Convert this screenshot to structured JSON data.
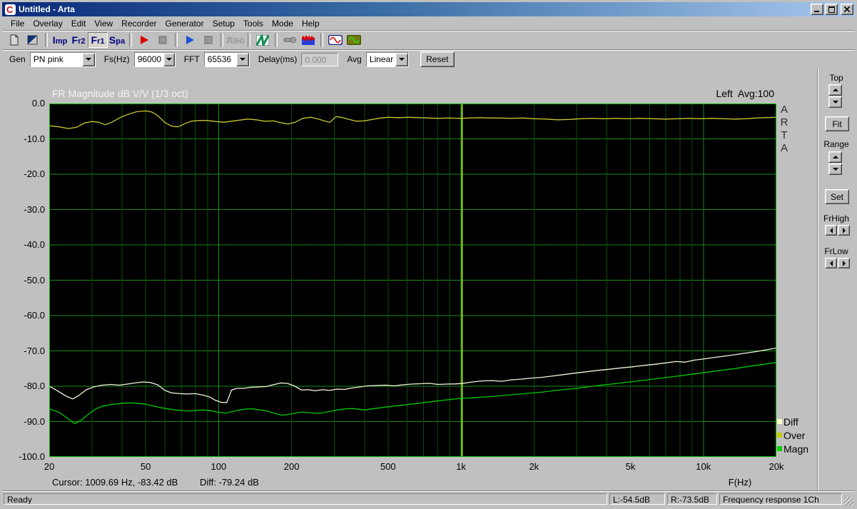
{
  "window": {
    "title": "Untitled - Arta"
  },
  "menu": {
    "items": [
      "File",
      "Overlay",
      "Edit",
      "View",
      "Recorder",
      "Generator",
      "Setup",
      "Tools",
      "Mode",
      "Help"
    ]
  },
  "toolbar": {
    "imp_label": "Imp",
    "fr2_label": "Fr2",
    "fr1_label": "Fr1",
    "spa_label": "Spa",
    "abc_label": "ABC"
  },
  "controls": {
    "gen_label": "Gen",
    "gen_value": "PN pink",
    "fs_label": "Fs(Hz)",
    "fs_value": "96000",
    "fft_label": "FFT",
    "fft_value": "65536",
    "delay_label": "Delay(ms)",
    "delay_value": "0.000",
    "avg_label": "Avg",
    "avg_value": "Linear",
    "reset_label": "Reset"
  },
  "side_panel": {
    "top_label": "Top",
    "fit_label": "Fit",
    "range_label": "Range",
    "set_label": "Set",
    "frhigh_label": "FrHigh",
    "frlow_label": "FrLow"
  },
  "status_bar": {
    "message": "Ready",
    "left_level": "L:-54.5dB",
    "right_level": "R:-73.5dB",
    "mode": "Frequency response 1Ch"
  },
  "chart_data": {
    "type": "line",
    "title": "FR Magnitude dB V/V (1/3 oct)",
    "channel_label": "Left  Avg:100",
    "xlabel": "F(Hz)",
    "x_scale": "log",
    "xlim": [
      20,
      20000
    ],
    "ylim": [
      -100,
      0
    ],
    "y_tick_labels": [
      "0.0",
      "-10.0",
      "-20.0",
      "-30.0",
      "-40.0",
      "-50.0",
      "-60.0",
      "-70.0",
      "-80.0",
      "-90.0",
      "-100.0"
    ],
    "x_ticks": [
      {
        "f": 20,
        "label": "20"
      },
      {
        "f": 50,
        "label": "50"
      },
      {
        "f": 100,
        "label": "100"
      },
      {
        "f": 200,
        "label": "200"
      },
      {
        "f": 500,
        "label": "500"
      },
      {
        "f": 1000,
        "label": "1k"
      },
      {
        "f": 2000,
        "label": "2k"
      },
      {
        "f": 5000,
        "label": "5k"
      },
      {
        "f": 10000,
        "label": "10k"
      },
      {
        "f": 20000,
        "label": "20k"
      }
    ],
    "cursor_freq": 1009.69,
    "cursor_readout": "Cursor: 1009.69 Hz, -83.42 dB",
    "diff_readout": "Diff: -79.24 dB",
    "watermark": "ARTA",
    "colors": {
      "bg": "#000000",
      "border": "#00b400",
      "grid_major": "#1d8a1d",
      "grid_minor": "#0b4c0b",
      "cursor": "#9ad500"
    },
    "legend": [
      {
        "label": "Diff",
        "color": "#ffffc8"
      },
      {
        "label": "Over",
        "color": "#c8c800"
      },
      {
        "label": "Magn",
        "color": "#00cc00"
      }
    ],
    "series": [
      {
        "name": "Over",
        "color": "#c6c632",
        "points": [
          [
            20,
            -6.3
          ],
          [
            22,
            -6.6
          ],
          [
            24,
            -7.1
          ],
          [
            26,
            -6.7
          ],
          [
            28,
            -5.5
          ],
          [
            30,
            -5.1
          ],
          [
            32,
            -5.3
          ],
          [
            34,
            -6.0
          ],
          [
            36,
            -5.4
          ],
          [
            38,
            -4.5
          ],
          [
            40,
            -3.7
          ],
          [
            43,
            -2.9
          ],
          [
            46,
            -2.3
          ],
          [
            50,
            -2.1
          ],
          [
            53,
            -2.4
          ],
          [
            56,
            -3.4
          ],
          [
            60,
            -5.4
          ],
          [
            64,
            -6.4
          ],
          [
            68,
            -6.6
          ],
          [
            72,
            -5.8
          ],
          [
            77,
            -5.0
          ],
          [
            83,
            -4.8
          ],
          [
            90,
            -4.8
          ],
          [
            97,
            -5.1
          ],
          [
            105,
            -5.3
          ],
          [
            113,
            -5.0
          ],
          [
            122,
            -4.7
          ],
          [
            132,
            -4.4
          ],
          [
            143,
            -4.6
          ],
          [
            155,
            -5.0
          ],
          [
            168,
            -4.9
          ],
          [
            180,
            -5.4
          ],
          [
            193,
            -5.8
          ],
          [
            207,
            -5.3
          ],
          [
            222,
            -4.2
          ],
          [
            240,
            -3.9
          ],
          [
            258,
            -4.4
          ],
          [
            275,
            -5.0
          ],
          [
            288,
            -5.3
          ],
          [
            305,
            -3.7
          ],
          [
            320,
            -3.9
          ],
          [
            345,
            -4.5
          ],
          [
            370,
            -5.0
          ],
          [
            400,
            -4.9
          ],
          [
            430,
            -4.5
          ],
          [
            465,
            -4.1
          ],
          [
            500,
            -3.9
          ],
          [
            550,
            -4.0
          ],
          [
            610,
            -3.9
          ],
          [
            670,
            -4.0
          ],
          [
            740,
            -4.1
          ],
          [
            810,
            -4.2
          ],
          [
            890,
            -4.1
          ],
          [
            980,
            -4.2
          ],
          [
            1080,
            -4.1
          ],
          [
            1190,
            -4.0
          ],
          [
            1310,
            -4.1
          ],
          [
            1450,
            -4.1
          ],
          [
            1600,
            -4.2
          ],
          [
            1800,
            -4.1
          ],
          [
            2000,
            -4.3
          ],
          [
            2250,
            -4.4
          ],
          [
            2500,
            -4.6
          ],
          [
            2800,
            -4.5
          ],
          [
            3100,
            -4.3
          ],
          [
            3500,
            -4.2
          ],
          [
            3900,
            -4.3
          ],
          [
            4400,
            -4.2
          ],
          [
            4900,
            -4.3
          ],
          [
            5500,
            -4.2
          ],
          [
            6200,
            -4.3
          ],
          [
            7000,
            -4.4
          ],
          [
            7800,
            -4.3
          ],
          [
            8700,
            -4.2
          ],
          [
            9700,
            -4.3
          ],
          [
            10800,
            -4.2
          ],
          [
            12000,
            -4.3
          ],
          [
            13500,
            -4.4
          ],
          [
            15000,
            -4.3
          ],
          [
            16500,
            -4.1
          ],
          [
            18000,
            -4.0
          ],
          [
            20000,
            -3.9
          ]
        ]
      },
      {
        "name": "Diff",
        "color": "#f4f4dc",
        "points": [
          [
            20,
            -80.0
          ],
          [
            21.5,
            -81.2
          ],
          [
            23.5,
            -82.8
          ],
          [
            25,
            -83.6
          ],
          [
            26.5,
            -82.6
          ],
          [
            28.5,
            -81.0
          ],
          [
            30.5,
            -80.2
          ],
          [
            33,
            -79.7
          ],
          [
            36,
            -79.5
          ],
          [
            39,
            -79.7
          ],
          [
            42,
            -79.4
          ],
          [
            45,
            -79.1
          ],
          [
            48.5,
            -78.8
          ],
          [
            52,
            -78.9
          ],
          [
            56,
            -79.6
          ],
          [
            60,
            -81.2
          ],
          [
            64,
            -81.9
          ],
          [
            69,
            -82.1
          ],
          [
            74,
            -82.2
          ],
          [
            80,
            -82.1
          ],
          [
            86,
            -82.5
          ],
          [
            92,
            -83.1
          ],
          [
            97,
            -84.0
          ],
          [
            103,
            -84.6
          ],
          [
            108,
            -84.6
          ],
          [
            113,
            -81.1
          ],
          [
            119,
            -80.6
          ],
          [
            127,
            -80.6
          ],
          [
            136,
            -80.3
          ],
          [
            146,
            -80.2
          ],
          [
            157,
            -80.1
          ],
          [
            168,
            -79.6
          ],
          [
            180,
            -79.1
          ],
          [
            192,
            -79.2
          ],
          [
            205,
            -79.9
          ],
          [
            220,
            -81.1
          ],
          [
            235,
            -81.0
          ],
          [
            250,
            -81.3
          ],
          [
            268,
            -81.0
          ],
          [
            288,
            -81.2
          ],
          [
            308,
            -80.8
          ],
          [
            330,
            -80.9
          ],
          [
            355,
            -80.5
          ],
          [
            382,
            -80.2
          ],
          [
            412,
            -79.9
          ],
          [
            448,
            -79.8
          ],
          [
            488,
            -79.7
          ],
          [
            530,
            -79.9
          ],
          [
            575,
            -79.6
          ],
          [
            625,
            -79.4
          ],
          [
            680,
            -79.3
          ],
          [
            740,
            -79.2
          ],
          [
            805,
            -79.5
          ],
          [
            875,
            -79.4
          ],
          [
            945,
            -79.35
          ],
          [
            1010,
            -79.24
          ],
          [
            1110,
            -78.8
          ],
          [
            1220,
            -78.5
          ],
          [
            1340,
            -78.4
          ],
          [
            1470,
            -78.6
          ],
          [
            1610,
            -78.2
          ],
          [
            1770,
            -78.0
          ],
          [
            1950,
            -77.7
          ],
          [
            2150,
            -77.5
          ],
          [
            2400,
            -77.1
          ],
          [
            2650,
            -76.7
          ],
          [
            2950,
            -76.3
          ],
          [
            3300,
            -75.9
          ],
          [
            3700,
            -75.5
          ],
          [
            4100,
            -75.2
          ],
          [
            4600,
            -74.8
          ],
          [
            5100,
            -74.5
          ],
          [
            5700,
            -74.1
          ],
          [
            6300,
            -73.8
          ],
          [
            7000,
            -73.4
          ],
          [
            7700,
            -73.0
          ],
          [
            8400,
            -73.2
          ],
          [
            9200,
            -72.6
          ],
          [
            10000,
            -72.3
          ],
          [
            11000,
            -71.9
          ],
          [
            12200,
            -71.5
          ],
          [
            13500,
            -71.1
          ],
          [
            15000,
            -70.6
          ],
          [
            16500,
            -70.2
          ],
          [
            18200,
            -69.7
          ],
          [
            20000,
            -69.2
          ]
        ]
      },
      {
        "name": "Magn",
        "color": "#00c800",
        "points": [
          [
            20,
            -86.4
          ],
          [
            22,
            -87.4
          ],
          [
            24,
            -89.3
          ],
          [
            25.5,
            -90.6
          ],
          [
            27,
            -89.7
          ],
          [
            29,
            -87.9
          ],
          [
            31,
            -86.5
          ],
          [
            33,
            -85.7
          ],
          [
            36,
            -85.2
          ],
          [
            39,
            -84.9
          ],
          [
            42,
            -84.7
          ],
          [
            46,
            -84.8
          ],
          [
            50,
            -85.1
          ],
          [
            54,
            -85.6
          ],
          [
            58,
            -86.1
          ],
          [
            63,
            -86.5
          ],
          [
            68,
            -86.8
          ],
          [
            74,
            -87.0
          ],
          [
            80,
            -86.9
          ],
          [
            86,
            -86.7
          ],
          [
            92,
            -86.9
          ],
          [
            99,
            -87.3
          ],
          [
            106,
            -87.6
          ],
          [
            112,
            -87.3
          ],
          [
            120,
            -86.8
          ],
          [
            128,
            -86.5
          ],
          [
            138,
            -86.4
          ],
          [
            148,
            -86.7
          ],
          [
            160,
            -87.1
          ],
          [
            170,
            -87.7
          ],
          [
            182,
            -88.2
          ],
          [
            193,
            -88.0
          ],
          [
            207,
            -87.6
          ],
          [
            222,
            -87.3
          ],
          [
            238,
            -87.5
          ],
          [
            254,
            -87.7
          ],
          [
            270,
            -87.5
          ],
          [
            290,
            -87.1
          ],
          [
            310,
            -86.7
          ],
          [
            333,
            -86.4
          ],
          [
            356,
            -86.3
          ],
          [
            378,
            -86.5
          ],
          [
            400,
            -86.7
          ],
          [
            430,
            -86.4
          ],
          [
            465,
            -86.1
          ],
          [
            505,
            -85.8
          ],
          [
            550,
            -85.5
          ],
          [
            600,
            -85.2
          ],
          [
            655,
            -84.9
          ],
          [
            710,
            -84.6
          ],
          [
            770,
            -84.3
          ],
          [
            840,
            -84.0
          ],
          [
            920,
            -83.7
          ],
          [
            1010,
            -83.42
          ],
          [
            1100,
            -83.3
          ],
          [
            1220,
            -83.1
          ],
          [
            1350,
            -82.9
          ],
          [
            1500,
            -82.6
          ],
          [
            1700,
            -82.3
          ],
          [
            1900,
            -82.0
          ],
          [
            2150,
            -81.7
          ],
          [
            2400,
            -81.3
          ],
          [
            2700,
            -80.9
          ],
          [
            3000,
            -80.6
          ],
          [
            3400,
            -80.1
          ],
          [
            3800,
            -79.7
          ],
          [
            4300,
            -79.3
          ],
          [
            4800,
            -78.9
          ],
          [
            5400,
            -78.5
          ],
          [
            6000,
            -78.1
          ],
          [
            6700,
            -77.7
          ],
          [
            7500,
            -77.3
          ],
          [
            8300,
            -76.9
          ],
          [
            9200,
            -76.5
          ],
          [
            10000,
            -76.2
          ],
          [
            11000,
            -75.8
          ],
          [
            12200,
            -75.4
          ],
          [
            13500,
            -75.0
          ],
          [
            15000,
            -74.5
          ],
          [
            16500,
            -74.1
          ],
          [
            18200,
            -73.7
          ],
          [
            20000,
            -73.3
          ]
        ]
      }
    ]
  }
}
